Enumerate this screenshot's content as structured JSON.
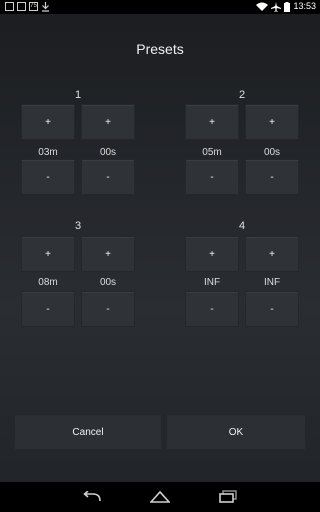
{
  "status": {
    "notif_badge": "75",
    "time": "13:53"
  },
  "dialog": {
    "title": "Presets"
  },
  "presets": [
    {
      "label": "1",
      "plus": "+",
      "minus": "-",
      "min": "03m",
      "sec": "00s"
    },
    {
      "label": "2",
      "plus": "+",
      "minus": "-",
      "min": "05m",
      "sec": "00s"
    },
    {
      "label": "3",
      "plus": "+",
      "minus": "-",
      "min": "08m",
      "sec": "00s"
    },
    {
      "label": "4",
      "plus": "+",
      "minus": "-",
      "min": "INF",
      "sec": "INF"
    }
  ],
  "actions": {
    "cancel": "Cancel",
    "ok": "OK"
  },
  "icons": {
    "status": [
      "image-icon",
      "clipboard-icon",
      "badge-icon",
      "download-icon",
      "wifi-icon",
      "airplane-icon",
      "battery-icon"
    ],
    "nav": [
      "back-icon",
      "home-icon",
      "recents-icon"
    ]
  }
}
